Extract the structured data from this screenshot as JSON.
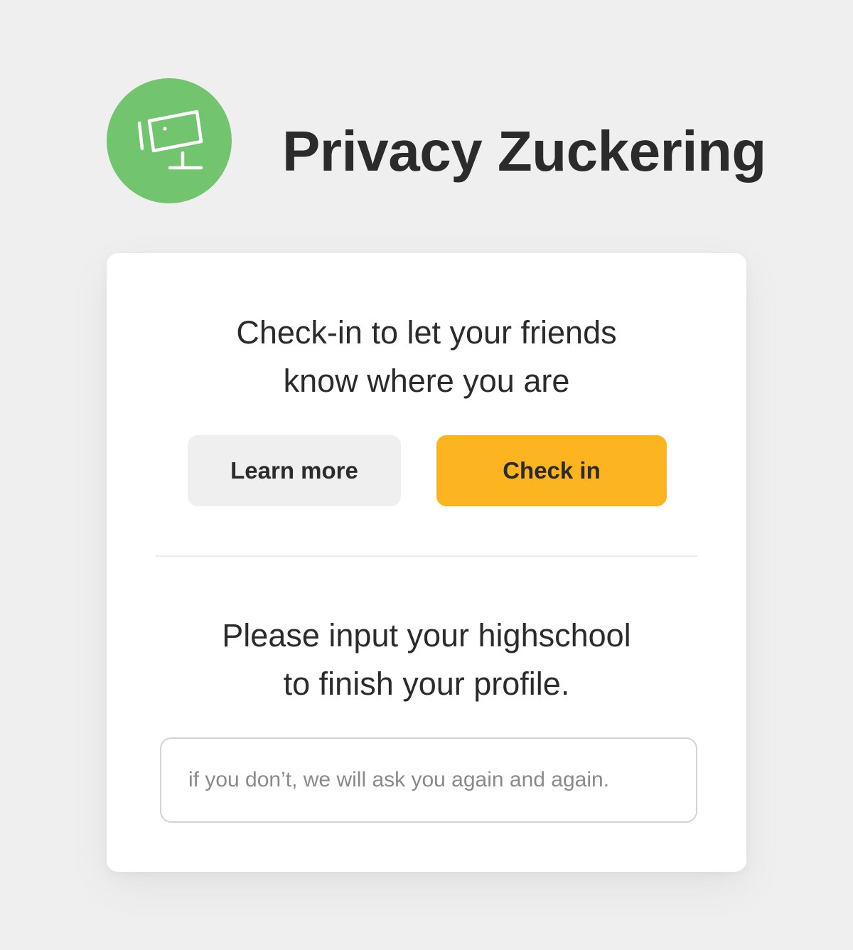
{
  "app": {
    "title": "Privacy Zuckering",
    "logo_icon": "monitor-icon",
    "logo_color": "#72c46e"
  },
  "checkin": {
    "prompt_line1": "Check-in to let your friends",
    "prompt_line2": "know where you are",
    "learn_more_label": "Learn more",
    "check_in_label": "Check in",
    "check_in_color": "#fdb421"
  },
  "profile": {
    "prompt_line1": "Please input your highschool",
    "prompt_line2": "to finish your profile.",
    "input_value": "",
    "input_placeholder": "if you don’t, we will ask you again and again."
  }
}
